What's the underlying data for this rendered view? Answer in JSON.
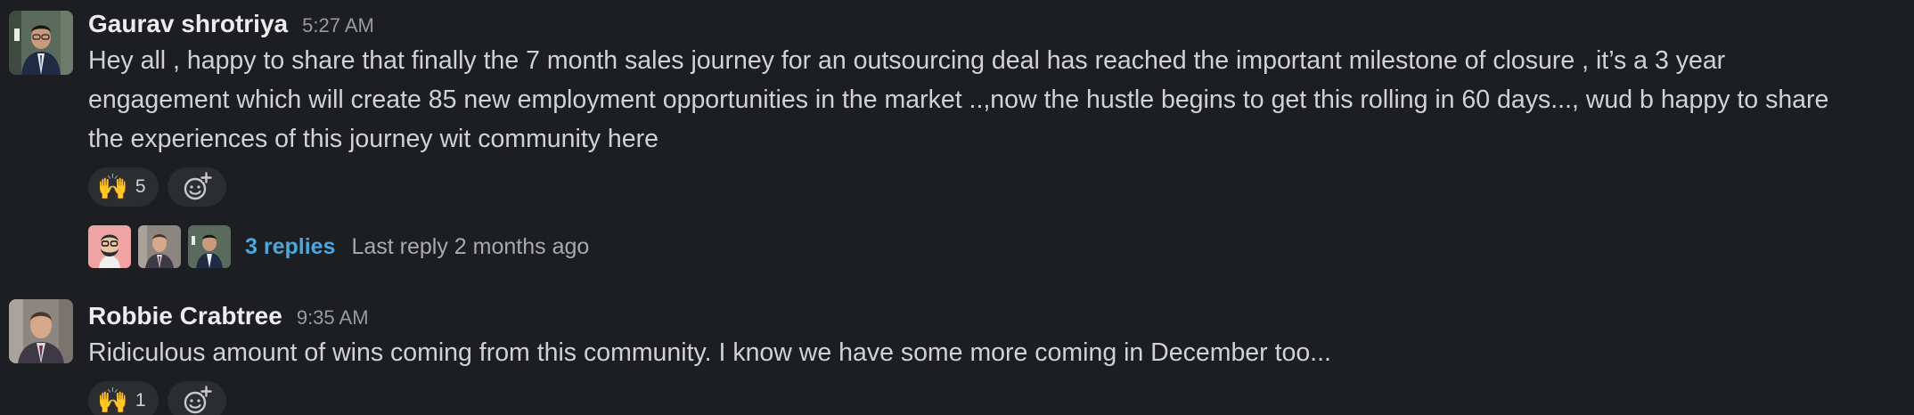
{
  "messages": [
    {
      "author": "Gaurav shrotriya",
      "time": "5:27 AM",
      "lines": [
        "Hey all , happy to share that finally the 7 month sales journey for an outsourcing deal has reached the important milestone of closure , it’s a 3 year",
        "engagement which will create 85 new employment opportunities in the market ..,now the hustle begins to get this rolling in 60 days..., wud b happy to share",
        "the experiences of this journey  wit community here"
      ],
      "reaction": {
        "emoji": "🙌",
        "emoji_name": "raised-hands",
        "count": "5"
      },
      "thread": {
        "avatars": [
          "avatar-glasses-illustration",
          "avatar-robbie-crabtree",
          "avatar-gaurav-shrotriya"
        ],
        "replies_label": "3 replies",
        "last_reply": "Last reply 2 months ago"
      }
    },
    {
      "author": "Robbie Crabtree",
      "time": "9:35 AM",
      "lines": [
        "Ridiculous amount of wins coming from this community. I know we have some more coming in December too..."
      ],
      "reaction": {
        "emoji": "🙌",
        "emoji_name": "raised-hands",
        "count": "1"
      }
    }
  ],
  "icons": {
    "add_reaction": "add-reaction-icon"
  },
  "colors": {
    "background": "#1d1e21",
    "link": "#4ea6dc",
    "reaction_bg": "#2c2d30"
  }
}
